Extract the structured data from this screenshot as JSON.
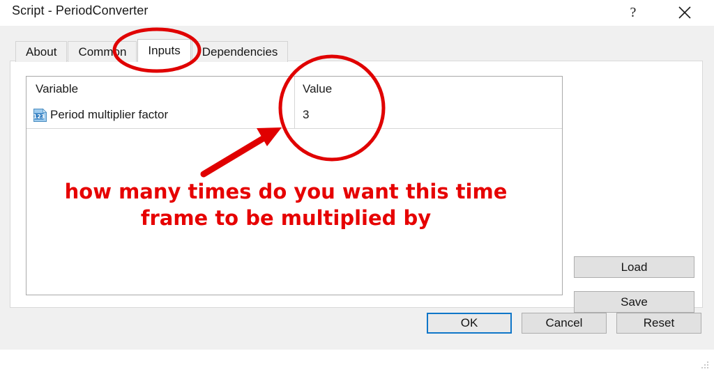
{
  "window": {
    "title": "Script - PeriodConverter",
    "help_label": "?",
    "close_label": "✕"
  },
  "tabs": [
    {
      "label": "About",
      "selected": false
    },
    {
      "label": "Common",
      "selected": false
    },
    {
      "label": "Inputs",
      "selected": true
    },
    {
      "label": "Dependencies",
      "selected": false
    }
  ],
  "inputs_table": {
    "columns": [
      "Variable",
      "Value"
    ],
    "rows": [
      {
        "icon": "number-input-icon",
        "icon_text": "123",
        "variable": "Period multiplier factor",
        "value": "3"
      }
    ]
  },
  "side_buttons": [
    {
      "label": "Load"
    },
    {
      "label": "Save"
    }
  ],
  "footer_buttons": [
    {
      "label": "OK",
      "default": true
    },
    {
      "label": "Cancel",
      "default": false
    },
    {
      "label": "Reset",
      "default": false
    }
  ],
  "annotation": {
    "text_line1": "how many times do you want this time",
    "text_line2": "frame to be multiplied by",
    "color": "#e60000",
    "marks": [
      "ellipse-around-inputs-tab",
      "circle-around-value",
      "arrow-pointing-to-value"
    ]
  },
  "colors": {
    "accent": "#0f76c8",
    "annotation_red": "#e60000",
    "dialog_background": "#f0f0f0",
    "panel_background": "#ffffff",
    "button_face": "#e1e1e1",
    "icon_blue": "#3f8fd0"
  }
}
